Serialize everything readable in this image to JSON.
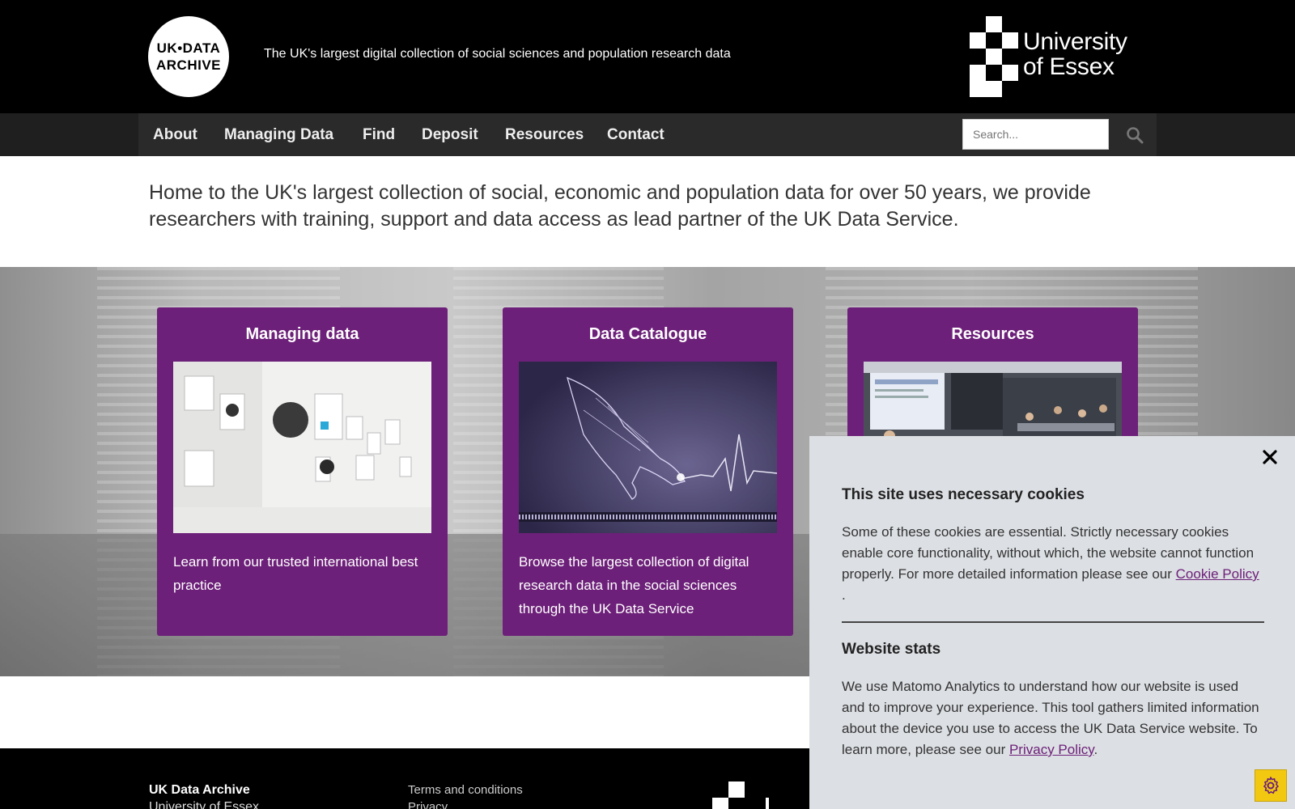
{
  "header": {
    "logo_line1": "UK•DATA",
    "logo_line2": "ARCHIVE",
    "tagline": "The UK's largest digital collection of social sciences and population research data",
    "partner_logo_line1": "University",
    "partner_logo_line2": "of Essex"
  },
  "nav": {
    "items": [
      "About",
      "Managing Data",
      "Find",
      "Deposit",
      "Resources",
      "Contact"
    ],
    "search_placeholder": "Search..."
  },
  "intro": "Home to the UK's largest collection of social, economic and population data for over 50 years, we provide researchers with training, support and data access as lead partner of the UK Data Service.",
  "cards": [
    {
      "title": "Managing data",
      "text": "Learn from our trusted international best practice"
    },
    {
      "title": "Data Catalogue",
      "text": "Browse the largest collection of digital research data in the social sciences through the UK Data Service"
    },
    {
      "title": "Resources",
      "text": ""
    }
  ],
  "footer": {
    "org": "UK Data Archive",
    "org_sub": "University of Essex",
    "link1": "Terms and conditions",
    "link2": "Privacy"
  },
  "cookie": {
    "heading1": "This site uses necessary cookies",
    "body1": "Some of these cookies are essential. Strictly necessary cookies enable core functionality, without which, the website cannot function properly. For more detailed information please see our",
    "link1": "Cookie Policy",
    "after1": ".",
    "heading2": "Website stats",
    "body2": "We use Matomo Analytics to understand how our website is used and to improve your experience. This tool gathers limited information about the device you use to access the UK Data Service website. To learn more, please see our",
    "link2": "Privacy Policy",
    "after2": "."
  },
  "colors": {
    "brand_purple": "#6d2079",
    "header_bg": "#000000",
    "nav_bg": "#2a2a2a",
    "cookie_bg": "#dcdfe3",
    "settings_yellow": "#f2c811"
  },
  "icons": {
    "search": "search-icon",
    "close": "close-icon",
    "settings": "gear-icon"
  }
}
